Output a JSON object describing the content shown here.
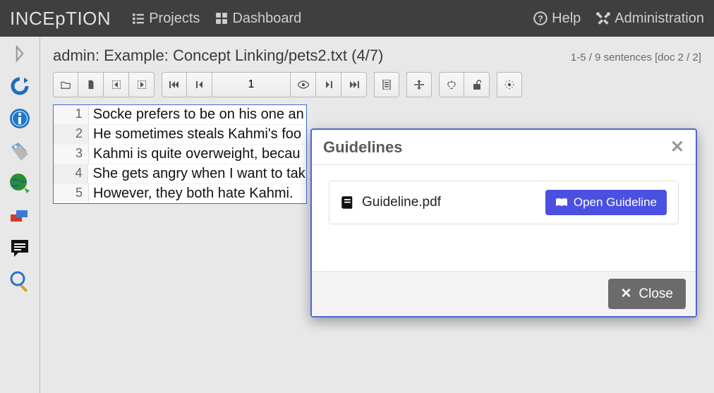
{
  "navbar": {
    "brand": "INCEpTION",
    "projects": "Projects",
    "dashboard": "Dashboard",
    "help": "Help",
    "administration": "Administration"
  },
  "doc": {
    "title": "admin: Example: Concept Linking/pets2.txt (4/7)",
    "status": "1-5 / 9 sentences [doc 2 / 2]",
    "page": "1"
  },
  "editor": {
    "lines": [
      {
        "n": "1",
        "text": "Socke prefers to be on his one an"
      },
      {
        "n": "2",
        "text": "He sometimes steals Kahmi's foo"
      },
      {
        "n": "3",
        "text": "Kahmi is quite overweight, becau"
      },
      {
        "n": "4",
        "text": "She gets angry when I want to tak"
      },
      {
        "n": "5",
        "text": "However, they both hate Kahmi."
      }
    ]
  },
  "modal": {
    "title": "Guidelines",
    "item": "Guideline.pdf",
    "open_label": "Open Guideline",
    "close_label": "Close"
  }
}
